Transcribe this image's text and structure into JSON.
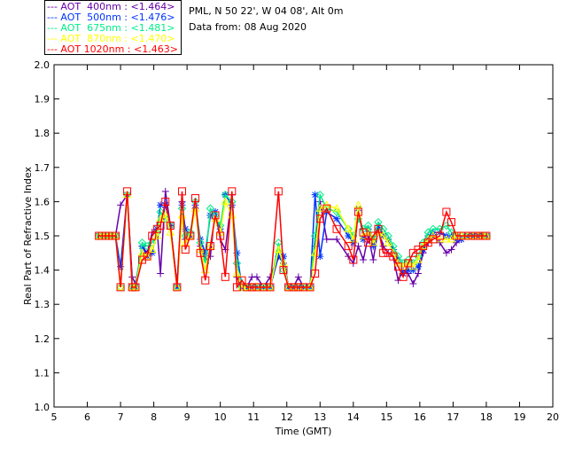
{
  "legend": [
    {
      "text": "--- AOT  400nm : <1.464>",
      "color": "#6600aa"
    },
    {
      "text": "--- AOT  500nm : <1.476>",
      "color": "#0033ff"
    },
    {
      "text": "--- AOT  675nm : <1.481>",
      "color": "#00ee88"
    },
    {
      "text": "--- AOT  870nm : <1.470>",
      "color": "#ffff00"
    },
    {
      "text": "--- AOT 1020nm : <1.463>",
      "color": "#ff0000"
    }
  ],
  "annotation": {
    "line1": "PML, N 50 22', W 04 08', Alt 0m",
    "line2": "Data from: 08 Aug 2020"
  },
  "chart_data": {
    "type": "line",
    "xlabel": "Time (GMT)",
    "ylabel": "Real Part of Refractive Index",
    "xlim": [
      5,
      20
    ],
    "ylim": [
      1.0,
      2.0
    ],
    "xticks": [
      "5",
      "6",
      "7",
      "8",
      "9",
      "10",
      "11",
      "12",
      "13",
      "14",
      "15",
      "16",
      "17",
      "18",
      "19",
      "20"
    ],
    "yticks": [
      "1.0",
      "1.1",
      "1.2",
      "1.3",
      "1.4",
      "1.5",
      "1.6",
      "1.7",
      "1.8",
      "1.9",
      "2.0"
    ],
    "grid": false,
    "legend_placement": "top-left outside",
    "x": [
      6.35,
      6.45,
      6.55,
      6.65,
      6.75,
      6.85,
      7.0,
      7.2,
      7.35,
      7.45,
      7.65,
      7.8,
      7.95,
      8.1,
      8.2,
      8.35,
      8.5,
      8.7,
      8.85,
      8.95,
      9.1,
      9.25,
      9.4,
      9.55,
      9.7,
      9.85,
      10.0,
      10.15,
      10.35,
      10.5,
      10.65,
      10.8,
      10.95,
      11.1,
      11.3,
      11.5,
      11.75,
      11.9,
      12.05,
      12.2,
      12.35,
      12.5,
      12.7,
      12.85,
      13.0,
      13.2,
      13.5,
      13.85,
      14.0,
      14.15,
      14.3,
      14.45,
      14.6,
      14.75,
      14.9,
      15.05,
      15.2,
      15.35,
      15.5,
      15.65,
      15.8,
      15.95,
      16.1,
      16.25,
      16.4,
      16.6,
      16.8,
      16.95,
      17.1,
      17.25,
      17.45,
      17.6,
      17.75,
      17.9,
      18.0
    ],
    "series": [
      {
        "name": "AOT 400nm",
        "color": "#6600aa",
        "marker": "plus",
        "values": [
          1.5,
          1.5,
          1.5,
          1.5,
          1.5,
          1.5,
          1.59,
          1.62,
          1.38,
          1.36,
          1.47,
          1.45,
          1.51,
          1.52,
          1.39,
          1.63,
          1.53,
          1.36,
          1.6,
          1.49,
          1.51,
          1.58,
          1.47,
          1.43,
          1.44,
          1.57,
          1.49,
          1.46,
          1.62,
          1.38,
          1.35,
          1.35,
          1.38,
          1.38,
          1.35,
          1.38,
          1.44,
          1.42,
          1.35,
          1.35,
          1.38,
          1.35,
          1.35,
          1.47,
          1.6,
          1.49,
          1.49,
          1.44,
          1.42,
          1.47,
          1.43,
          1.5,
          1.43,
          1.52,
          1.47,
          1.45,
          1.44,
          1.37,
          1.4,
          1.39,
          1.36,
          1.39,
          1.45,
          1.48,
          1.5,
          1.48,
          1.45,
          1.46,
          1.48,
          1.49,
          1.5,
          1.5,
          1.5,
          1.5,
          1.5
        ]
      },
      {
        "name": "AOT 500nm",
        "color": "#0033ff",
        "marker": "asterisk",
        "values": [
          1.5,
          1.5,
          1.5,
          1.5,
          1.5,
          1.5,
          1.41,
          1.62,
          1.35,
          1.35,
          1.47,
          1.44,
          1.45,
          1.52,
          1.59,
          1.59,
          1.53,
          1.35,
          1.59,
          1.52,
          1.5,
          1.59,
          1.49,
          1.45,
          1.56,
          1.57,
          1.52,
          1.62,
          1.59,
          1.45,
          1.35,
          1.35,
          1.35,
          1.35,
          1.35,
          1.35,
          1.44,
          1.44,
          1.35,
          1.35,
          1.35,
          1.35,
          1.35,
          1.62,
          1.44,
          1.57,
          1.55,
          1.5,
          1.48,
          1.58,
          1.49,
          1.52,
          1.47,
          1.53,
          1.5,
          1.49,
          1.46,
          1.43,
          1.39,
          1.4,
          1.4,
          1.41,
          1.46,
          1.5,
          1.51,
          1.51,
          1.5,
          1.5,
          1.49,
          1.49,
          1.5,
          1.5,
          1.5,
          1.5,
          1.5
        ]
      },
      {
        "name": "AOT 675nm",
        "color": "#00ee88",
        "marker": "diamond",
        "values": [
          1.5,
          1.5,
          1.5,
          1.5,
          1.5,
          1.5,
          1.35,
          1.62,
          1.35,
          1.35,
          1.48,
          1.47,
          1.48,
          1.51,
          1.57,
          1.55,
          1.53,
          1.35,
          1.58,
          1.5,
          1.51,
          1.6,
          1.48,
          1.42,
          1.58,
          1.56,
          1.53,
          1.62,
          1.6,
          1.42,
          1.35,
          1.35,
          1.35,
          1.35,
          1.35,
          1.35,
          1.48,
          1.4,
          1.35,
          1.35,
          1.35,
          1.35,
          1.35,
          1.5,
          1.62,
          1.58,
          1.57,
          1.52,
          1.5,
          1.55,
          1.52,
          1.53,
          1.49,
          1.54,
          1.52,
          1.5,
          1.47,
          1.44,
          1.42,
          1.43,
          1.42,
          1.44,
          1.48,
          1.51,
          1.52,
          1.52,
          1.53,
          1.51,
          1.5,
          1.5,
          1.5,
          1.5,
          1.5,
          1.5,
          1.5
        ]
      },
      {
        "name": "AOT 870nm",
        "color": "#ffff00",
        "marker": "triangle",
        "values": [
          1.5,
          1.5,
          1.5,
          1.5,
          1.5,
          1.5,
          1.35,
          1.62,
          1.35,
          1.35,
          1.45,
          1.44,
          1.46,
          1.5,
          1.55,
          1.56,
          1.51,
          1.35,
          1.56,
          1.48,
          1.5,
          1.58,
          1.46,
          1.4,
          1.47,
          1.55,
          1.51,
          1.6,
          1.56,
          1.39,
          1.35,
          1.35,
          1.35,
          1.35,
          1.35,
          1.35,
          1.46,
          1.42,
          1.35,
          1.35,
          1.35,
          1.35,
          1.35,
          1.45,
          1.58,
          1.59,
          1.58,
          1.52,
          1.49,
          1.59,
          1.5,
          1.51,
          1.48,
          1.51,
          1.5,
          1.48,
          1.45,
          1.42,
          1.41,
          1.42,
          1.41,
          1.43,
          1.47,
          1.49,
          1.5,
          1.49,
          1.49,
          1.49,
          1.5,
          1.5,
          1.5,
          1.5,
          1.5,
          1.5,
          1.5
        ]
      },
      {
        "name": "AOT 1020nm",
        "color": "#ff0000",
        "marker": "square",
        "values": [
          1.5,
          1.5,
          1.5,
          1.5,
          1.5,
          1.5,
          1.35,
          1.63,
          1.35,
          1.35,
          1.43,
          1.44,
          1.5,
          1.52,
          1.53,
          1.6,
          1.53,
          1.35,
          1.63,
          1.46,
          1.5,
          1.61,
          1.45,
          1.37,
          1.47,
          1.56,
          1.5,
          1.38,
          1.63,
          1.35,
          1.37,
          1.35,
          1.35,
          1.35,
          1.35,
          1.35,
          1.63,
          1.4,
          1.35,
          1.35,
          1.35,
          1.35,
          1.35,
          1.39,
          1.55,
          1.58,
          1.52,
          1.47,
          1.43,
          1.57,
          1.51,
          1.48,
          1.5,
          1.52,
          1.45,
          1.45,
          1.44,
          1.41,
          1.38,
          1.42,
          1.45,
          1.46,
          1.47,
          1.48,
          1.49,
          1.5,
          1.57,
          1.54,
          1.5,
          1.5,
          1.5,
          1.5,
          1.5,
          1.5,
          1.5
        ]
      }
    ]
  }
}
